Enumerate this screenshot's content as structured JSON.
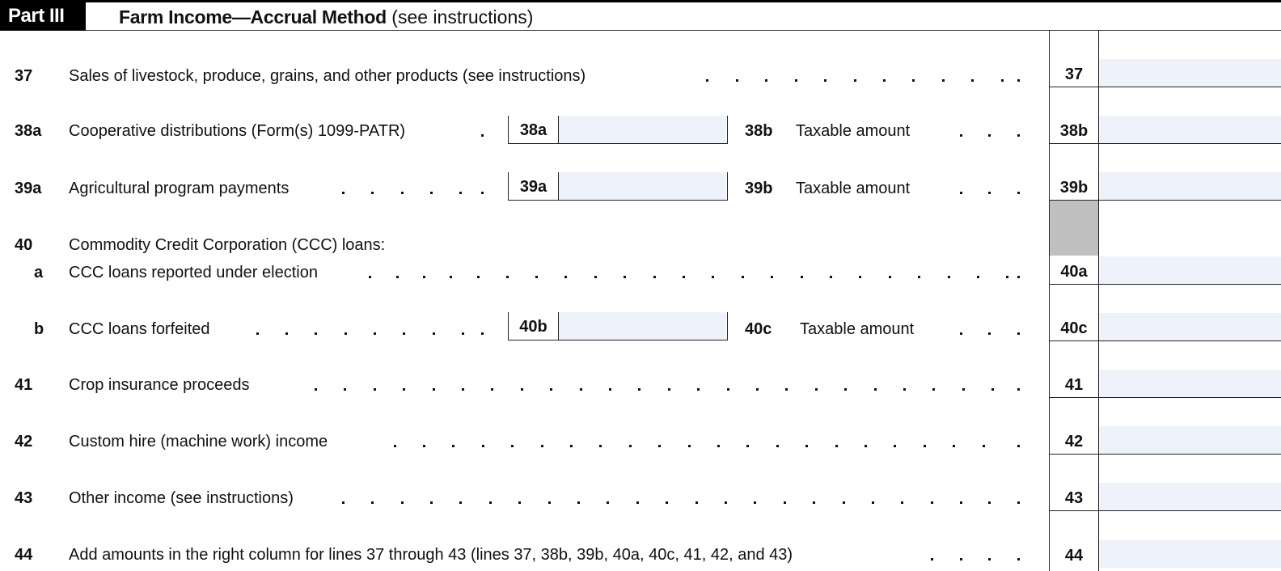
{
  "header": {
    "part_label": "Part III",
    "title_bold": "Farm Income—Accrual Method",
    "title_note": " (see instructions)"
  },
  "lines": {
    "l37": {
      "num": "37",
      "label": "Sales of livestock, produce, grains, and other products (see instructions)",
      "box": "37",
      "value": ""
    },
    "l38": {
      "num": "38a",
      "label": "Cooperative distributions (Form(s) 1099-PATR)",
      "inline_box": "38a",
      "inline_value": "",
      "sub_num": "38b",
      "sub_label": "Taxable amount",
      "box": "38b",
      "value": ""
    },
    "l39": {
      "num": "39a",
      "label": "Agricultural program payments",
      "inline_box": "39a",
      "inline_value": "",
      "sub_num": "39b",
      "sub_label": "Taxable amount",
      "box": "39b",
      "value": ""
    },
    "l40": {
      "num": "40",
      "label": "Commodity Credit Corporation (CCC) loans:"
    },
    "l40a": {
      "num": "a",
      "label": "CCC loans reported under election",
      "box": "40a",
      "value": ""
    },
    "l40b": {
      "num": "b",
      "label": "CCC loans forfeited",
      "inline_box": "40b",
      "inline_value": "",
      "sub_num": "40c",
      "sub_label": "Taxable amount",
      "box": "40c",
      "value": ""
    },
    "l41": {
      "num": "41",
      "label": "Crop insurance proceeds",
      "box": "41",
      "value": ""
    },
    "l42": {
      "num": "42",
      "label": "Custom hire (machine work) income",
      "box": "42",
      "value": ""
    },
    "l43": {
      "num": "43",
      "label": "Other income (see instructions)",
      "box": "43",
      "value": ""
    },
    "l44": {
      "num": "44",
      "label": "Add amounts in the right column for lines 37 through 43 (lines 37, 38b, 39b, 40a, 40c, 41, 42, and 43)",
      "box": "44",
      "value": ""
    }
  }
}
